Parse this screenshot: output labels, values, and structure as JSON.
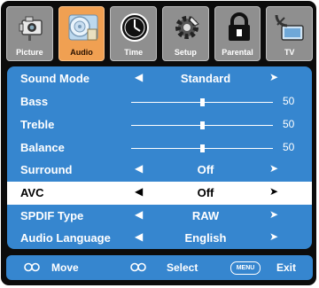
{
  "tabs": [
    {
      "label": "Picture",
      "icon": "camera-icon",
      "active": false
    },
    {
      "label": "Audio",
      "icon": "speaker-icon",
      "active": true
    },
    {
      "label": "Time",
      "icon": "clock-icon",
      "active": false
    },
    {
      "label": "Setup",
      "icon": "gear-icon",
      "active": false
    },
    {
      "label": "Parental",
      "icon": "lock-icon",
      "active": false
    },
    {
      "label": "TV",
      "icon": "satellite-tv-icon",
      "active": false
    }
  ],
  "menu": [
    {
      "label": "Sound Mode",
      "type": "select",
      "value": "Standard",
      "selected": false
    },
    {
      "label": "Bass",
      "type": "slider",
      "value": "50",
      "level": 0.5
    },
    {
      "label": "Treble",
      "type": "slider",
      "value": "50",
      "level": 0.5
    },
    {
      "label": "Balance",
      "type": "slider",
      "value": "50",
      "level": 0.5
    },
    {
      "label": "Surround",
      "type": "select",
      "value": "Off",
      "selected": false
    },
    {
      "label": "AVC",
      "type": "select",
      "value": "Off",
      "selected": true
    },
    {
      "label": "SPDIF Type",
      "type": "select",
      "value": "RAW",
      "selected": false
    },
    {
      "label": "Audio Language",
      "type": "select",
      "value": "English",
      "selected": false
    }
  ],
  "arrows": {
    "left": "◀",
    "right": "➤"
  },
  "footer": {
    "move_label": "Move",
    "select_label": "Select",
    "menu_key": "MENU",
    "exit_label": "Exit"
  },
  "colors": {
    "panel": "#3686cf",
    "active_tab": "#f0a052",
    "tab": "#8f8f8f",
    "frame": "#0c0c0c"
  }
}
